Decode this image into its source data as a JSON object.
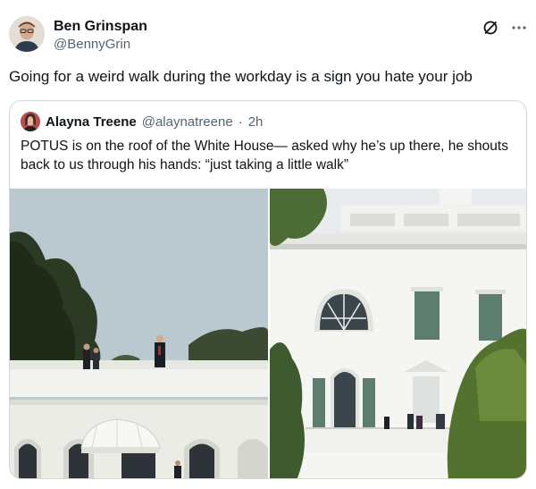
{
  "tweet": {
    "author": {
      "display_name": "Ben Grinspan",
      "handle": "@BennyGrin"
    },
    "text": "Going for a weird walk during the workday is a sign you hate your job",
    "actions": [
      "grok-icon",
      "more-icon"
    ]
  },
  "quote": {
    "author": {
      "display_name": "Alayna Treene",
      "handle": "@alaynatreene"
    },
    "separator": "·",
    "time": "2h",
    "text": "POTUS is on the roof of the White House— asked why he’s up there, he shouts back to us through his hands: “just taking a little walk”",
    "media_count": 2
  },
  "colors": {
    "text": "#0f1419",
    "muted": "#536471",
    "border": "#cfd9de",
    "sky": "#b9c9cf"
  }
}
